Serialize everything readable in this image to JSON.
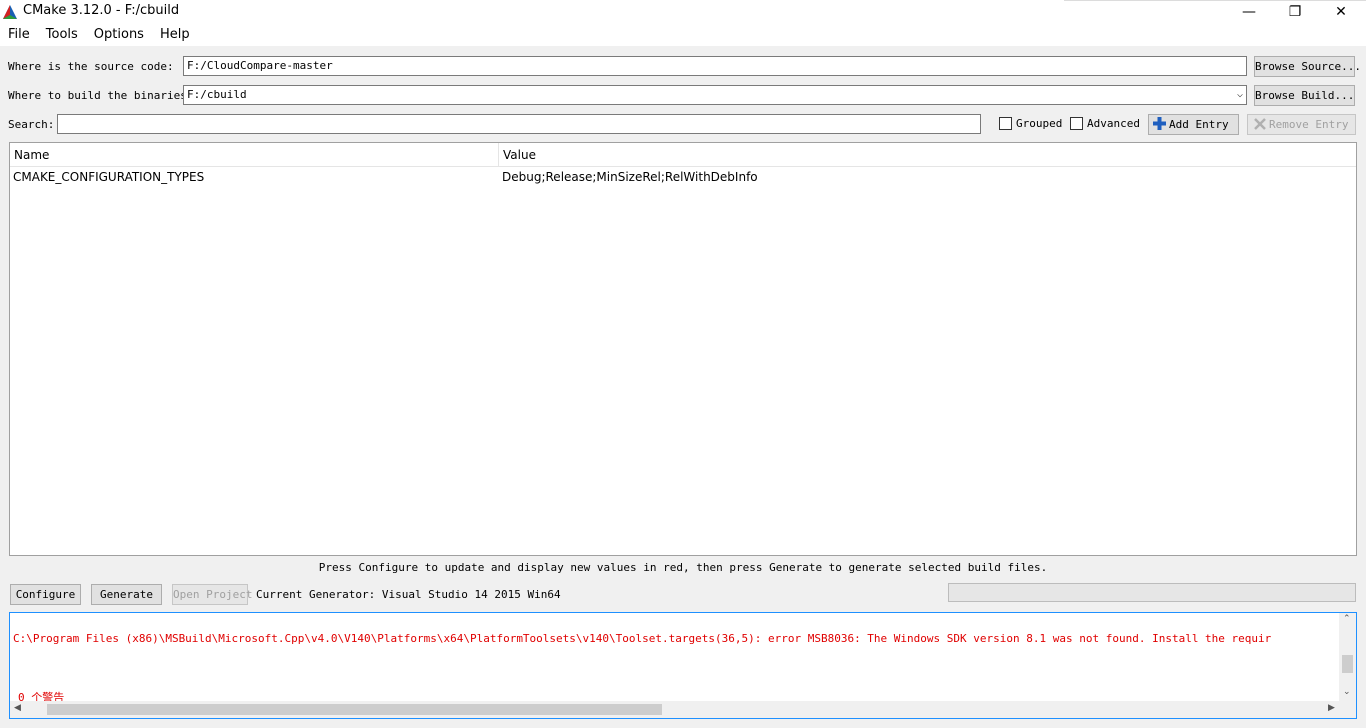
{
  "window": {
    "title": "CMake 3.12.0 - F:/cbuild",
    "minimize_glyph": "—",
    "restore_glyph": "❐",
    "close_glyph": "✕",
    "icon": "cmake-triangle-icon"
  },
  "menu": [
    "File",
    "Tools",
    "Options",
    "Help"
  ],
  "source": {
    "label": "Where is the source code:",
    "value": "F:/CloudCompare-master",
    "button": "Browse Source..."
  },
  "build": {
    "label": "Where to build the binaries:",
    "value": "F:/cbuild",
    "button": "Browse Build..."
  },
  "search": {
    "label": "Search:",
    "value": ""
  },
  "options": {
    "grouped": {
      "label": "Grouped",
      "checked": false
    },
    "advanced": {
      "label": "Advanced",
      "checked": false
    },
    "add_entry": "Add Entry",
    "remove_entry": "Remove Entry"
  },
  "table": {
    "columns": [
      "Name",
      "Value"
    ],
    "rows": [
      {
        "name": "CMAKE_CONFIGURATION_TYPES",
        "value": "Debug;Release;MinSizeRel;RelWithDebInfo"
      }
    ]
  },
  "hint": "Press Configure to update and display new values in red, then press Generate to generate selected build files.",
  "actions": {
    "configure": "Configure",
    "generate": "Generate",
    "open_project": "Open Project",
    "generator": "Current Generator: Visual Studio 14 2015 Win64"
  },
  "output": {
    "lines": [
      "C:\\Program Files (x86)\\MSBuild\\Microsoft.Cpp\\v4.0\\V140\\Platforms\\x64\\PlatformToolsets\\v140\\Toolset.targets(36,5): error MSB8036: The Windows SDK version 8.1 was not found. Install the requir",
      "  0 个警告"
    ],
    "color": "#e00000"
  },
  "colors": {
    "panel": "#f0f0f0",
    "focus_border": "#1e90ff",
    "error_text": "#e00000",
    "add_icon": "#1f5fbf"
  }
}
